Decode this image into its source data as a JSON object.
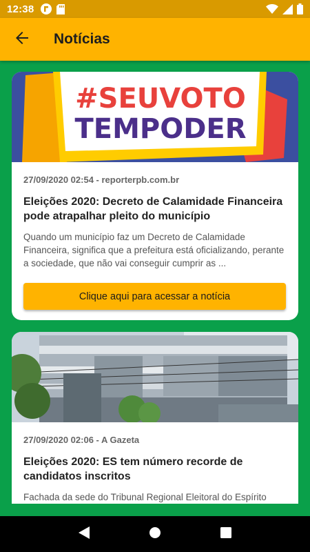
{
  "status_bar": {
    "time": "12:38",
    "left_icons": [
      "flipboard-icon",
      "sd-card-icon"
    ],
    "right_icons": [
      "wifi-icon",
      "signal-icon",
      "battery-icon"
    ]
  },
  "app_bar": {
    "title": "Notícias",
    "back_icon": "arrow-left-icon"
  },
  "colors": {
    "accent": "#ffb300",
    "status_bar": "#d99a00",
    "background": "#0aa04a",
    "card": "#ffffff"
  },
  "news": [
    {
      "image_text_line1": "#SEUVOTO",
      "image_text_line2": "TEMPODER",
      "meta": "27/09/2020 02:54 - reporterpb.com.br",
      "title": "Eleições 2020: Decreto de Calamidade Financeira pode atrapalhar pleito do município",
      "description": "Quando um município faz um Decreto de Calamidade Financeira, significa que a prefeitura está oficializando, perante a sociedade, que não vai conseguir cumprir as ...",
      "button_label": "Clique aqui para acessar a notícia"
    },
    {
      "meta": "27/09/2020 02:06 - A Gazeta",
      "title": "Eleições 2020: ES tem número recorde de candidatos inscritos",
      "description": "Fachada da sede do Tribunal Regional Eleitoral do Espírito Santo, em Vitória, onde o Tribunal Regional Eleitoral analisa"
    }
  ],
  "nav_bar": {
    "icons": [
      "back-triangle-icon",
      "home-circle-icon",
      "recents-square-icon"
    ]
  }
}
